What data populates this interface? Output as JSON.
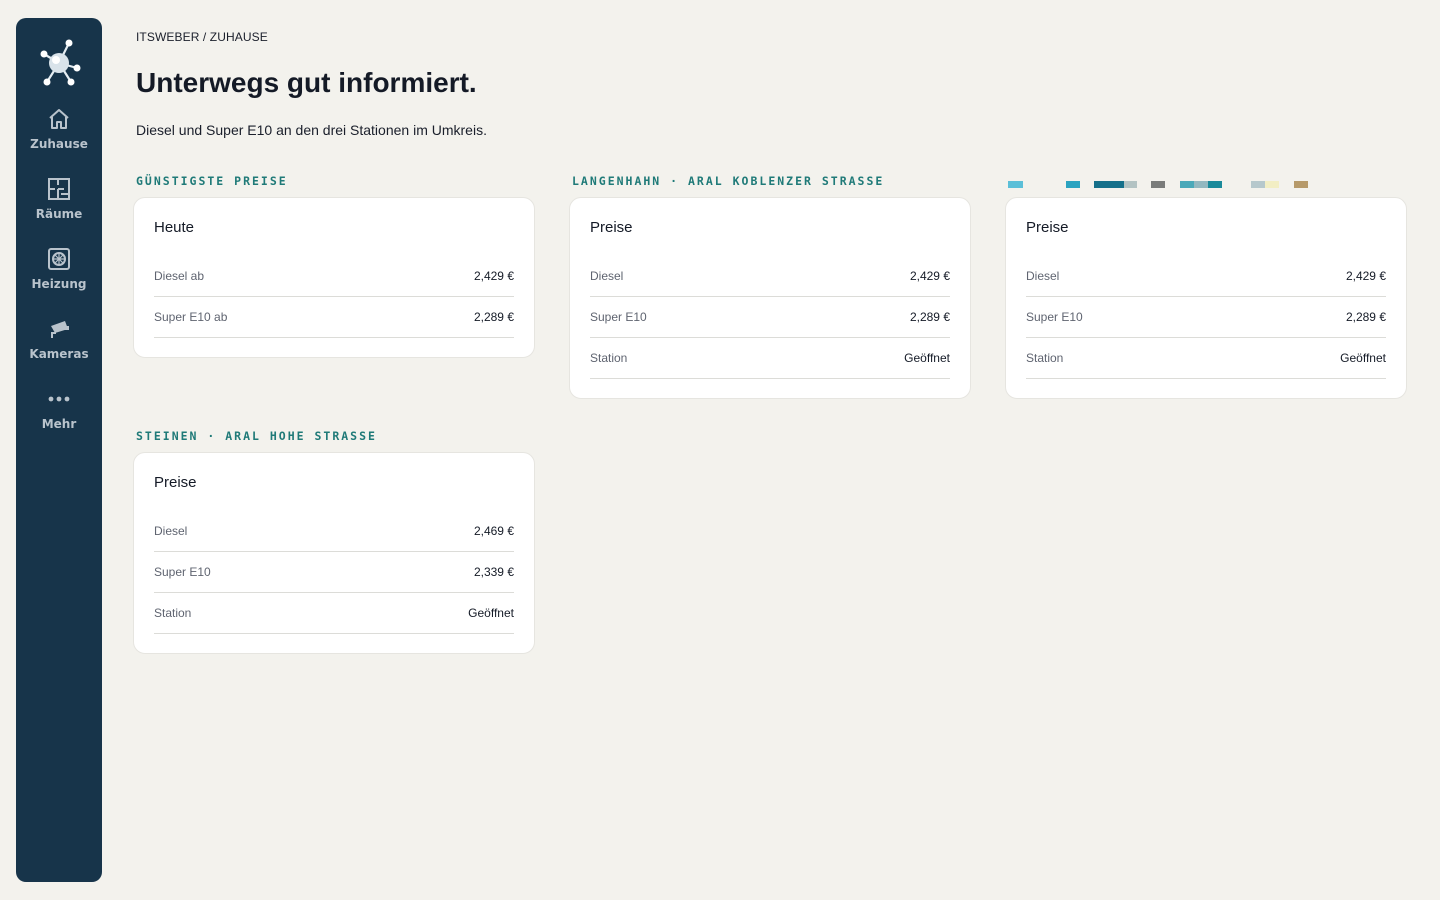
{
  "sidebar": {
    "items": [
      {
        "label": "Zuhause",
        "icon": "home-icon"
      },
      {
        "label": "Räume",
        "icon": "floorplan-icon"
      },
      {
        "label": "Heizung",
        "icon": "heating-icon"
      },
      {
        "label": "Kameras",
        "icon": "camera-icon"
      },
      {
        "label": "Mehr",
        "icon": "more-icon"
      }
    ]
  },
  "header": {
    "breadcrumb": "ITSWEBER / ZUHAUSE",
    "title": "Unterwegs gut informiert.",
    "subtitle": "Diesel und Super E10 an den drei Stationen im Umkreis."
  },
  "sections": [
    {
      "heading": "GÜNSTIGSTE PREISE",
      "card_title": "Heute",
      "rows": [
        {
          "label": "Diesel ab",
          "value": "2,429 €"
        },
        {
          "label": "Super E10 ab",
          "value": "2,289 €"
        }
      ]
    },
    {
      "heading": "LANGENHAHN · ARAL KOBLENZER STRASSE",
      "card_title": "Preise",
      "rows": [
        {
          "label": "Diesel",
          "value": "2,429 €"
        },
        {
          "label": "Super E10",
          "value": "2,289 €"
        },
        {
          "label": "Station",
          "value": "Geöffnet"
        }
      ]
    },
    {
      "heading": "",
      "card_title": "Preise",
      "rows": [
        {
          "label": "Diesel",
          "value": "2,429 €"
        },
        {
          "label": "Super E10",
          "value": "2,289 €"
        },
        {
          "label": "Station",
          "value": "Geöffnet"
        }
      ]
    },
    {
      "heading": "STEINEN · ARAL HOHE STRASSE",
      "card_title": "Preise",
      "rows": [
        {
          "label": "Diesel",
          "value": "2,469 €"
        },
        {
          "label": "Super E10",
          "value": "2,339 €"
        },
        {
          "label": "Station",
          "value": "Geöffnet"
        }
      ]
    }
  ],
  "colors": {
    "sidebar_bg": "#17344a",
    "page_bg": "#f3f2ed",
    "accent": "#1f7a78",
    "stripe": [
      "#5bbfd8",
      "#2ba3c0",
      "#15708a",
      "#b3c3c3",
      "#7a7c7a",
      "#4aa9b9",
      "#93b8c0",
      "#1a8a9a",
      "#b6c8cc",
      "#f2eec4",
      "#b69a6a"
    ]
  }
}
